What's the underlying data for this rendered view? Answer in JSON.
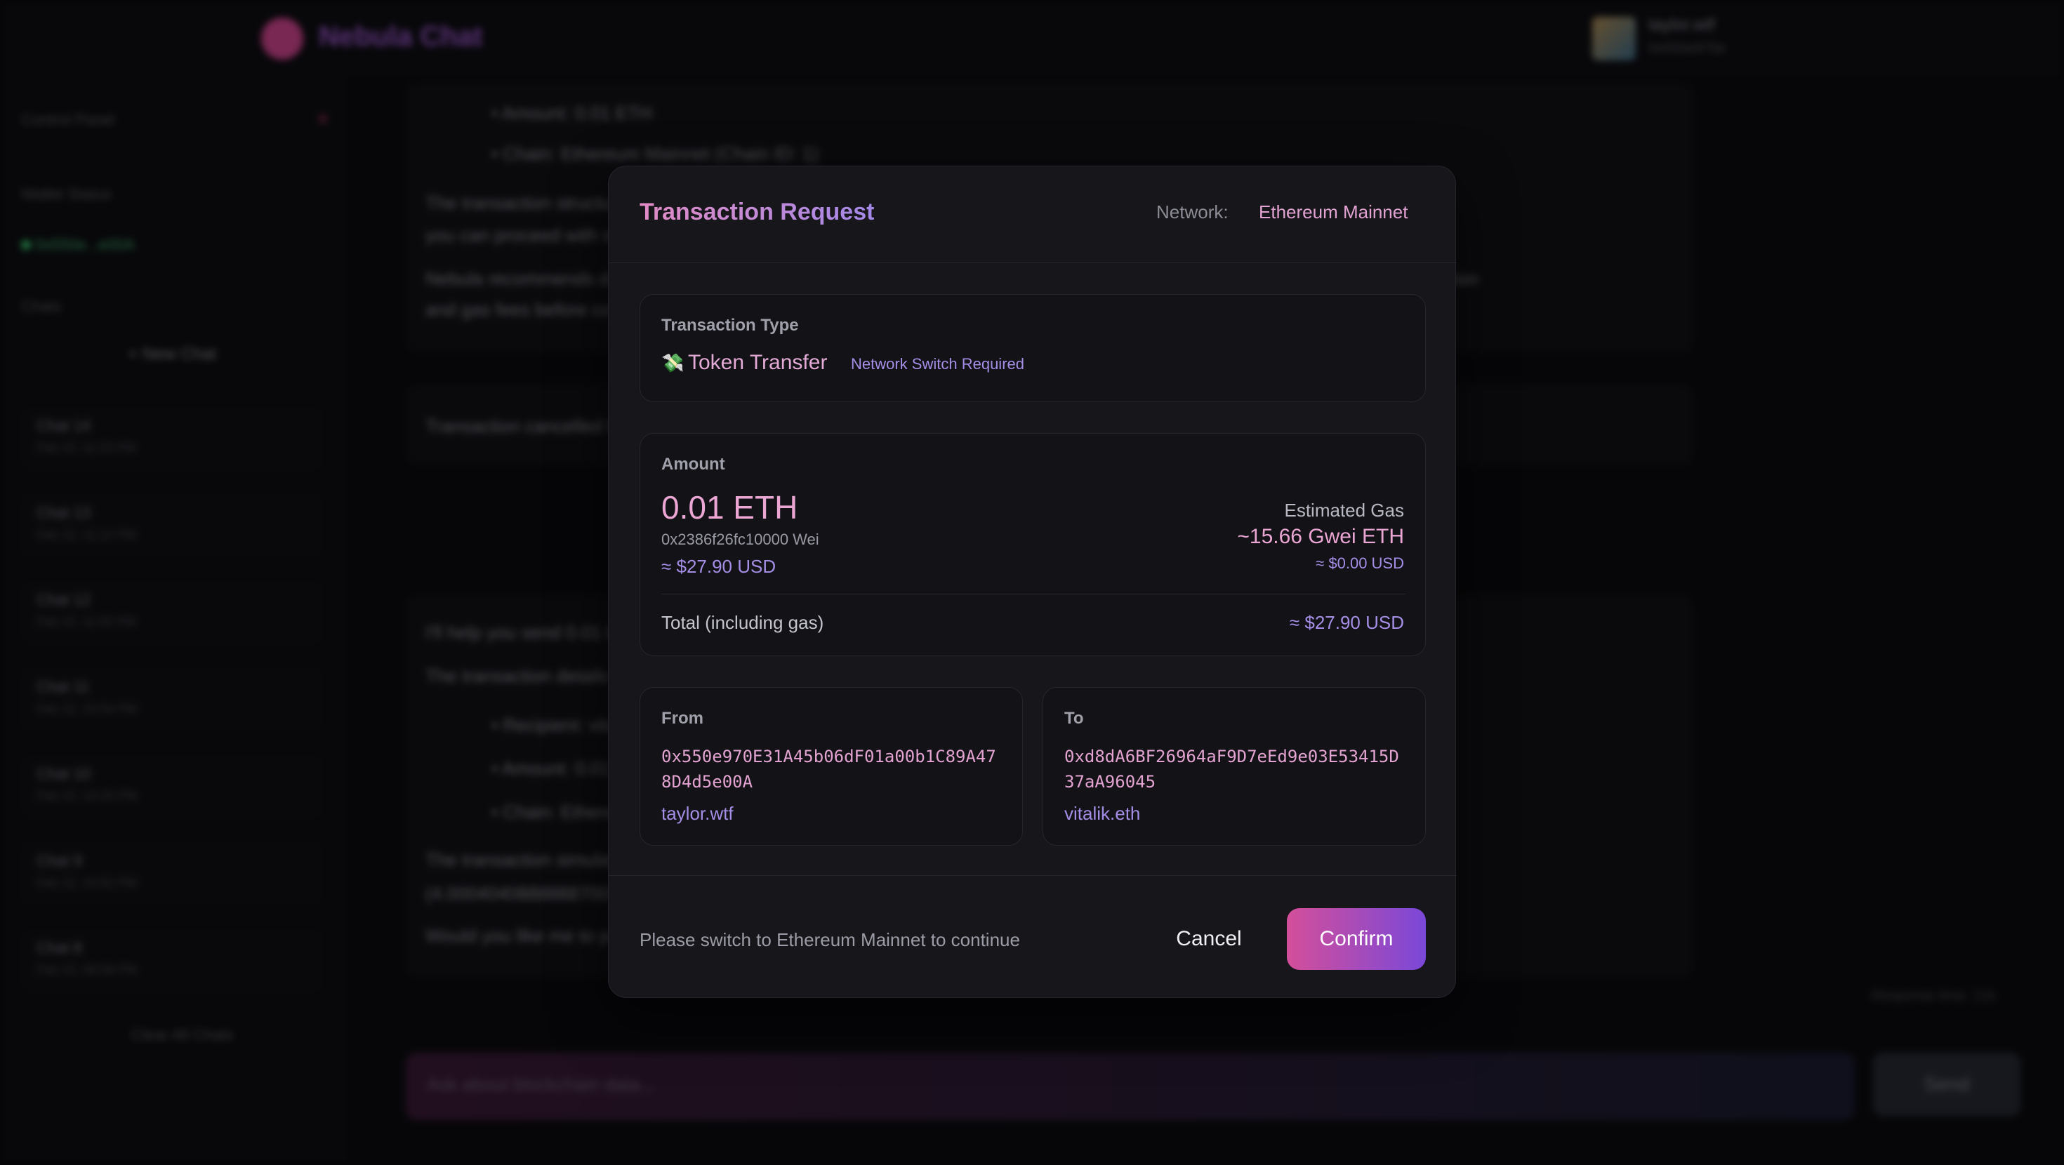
{
  "app": {
    "brand_name": "Nebula Chat",
    "user_name": "taylor.wtf",
    "user_sub": "0x550e970e"
  },
  "sidebar": {
    "control_panel_label": "Control Panel",
    "wallet_status_label": "Wallet Status",
    "wallet_address": "0x550e...e00A",
    "chats_label": "Chats",
    "new_chat_label": "+ New Chat",
    "chats": [
      {
        "title": "Chat 14",
        "date": "Feb 22, 11:23 PM"
      },
      {
        "title": "Chat 13",
        "date": "Feb 22, 11:12 PM"
      },
      {
        "title": "Chat 12",
        "date": "Feb 22, 11:02 PM"
      },
      {
        "title": "Chat 11",
        "date": "Feb 22, 10:54 PM"
      },
      {
        "title": "Chat 10",
        "date": "Feb 22, 10:20 PM"
      },
      {
        "title": "Chat 9",
        "date": "Feb 22, 10:02 PM"
      },
      {
        "title": "Chat 8",
        "date": "Feb 22, 09:58 PM"
      }
    ],
    "clear_all_label": "Clear All Chats"
  },
  "conversation": {
    "lines": [
      "• Amount: 0.01 ETH",
      "• Chain: Ethereum Mainnet (Chain ID: 1)",
      "The transaction structure looks correct, and your wallet connection is successfully prepared, and",
      "you can proceed with signing and sending the transaction through your wallet.",
      "Nebula recommends double-checking the recipient address and ensuring you have sufficient ETH balance to cover the transaction",
      "and gas fees before confirming.",
      "Transaction cancelled by user.",
      "I'll help you send 0.01 ETH to vitalik.eth.",
      "The transaction details are:",
      "• Recipient: vitalik.eth",
      "• Amount: 0.01 ETH",
      "• Chain: Ethereum Mainnet",
      "The transaction simulation indicates the transfer can proceed successfully. Your wallet has sufficient ETH balance",
      "(4.000404088888870000 ETH) to complete this transaction.",
      "Would you like me to proceed with this transaction?"
    ],
    "response_time": "Response time: 12s",
    "composer_placeholder": "Ask about blockchain data...",
    "send_label": "Send"
  },
  "modal": {
    "title": "Transaction Request",
    "network_label": "Network:",
    "network_value": "Ethereum Mainnet",
    "type": {
      "label": "Transaction Type",
      "icon": "money-wings-icon",
      "icon_glyph": "💸",
      "value": "Token Transfer",
      "badge": "Network Switch Required"
    },
    "amount": {
      "label": "Amount",
      "value": "0.01 ETH",
      "wei": "0x2386f26fc10000 Wei",
      "usd": "≈ $27.90 USD",
      "gas_label": "Estimated Gas",
      "gas_value": "~15.66 Gwei ETH",
      "gas_usd": "≈ $0.00 USD",
      "total_label": "Total (including gas)",
      "total_value": "≈ $27.90 USD"
    },
    "from": {
      "label": "From",
      "address": "0x550e970E31A45b06dF01a00b1C89A478D4d5e00A",
      "ens": "taylor.wtf"
    },
    "to": {
      "label": "To",
      "address": "0xd8dA6BF26964aF9D7eEd9e03E53415D37aA96045",
      "ens": "vitalik.eth"
    },
    "footer_message": "Please switch to Ethereum Mainnet to continue",
    "cancel_label": "Cancel",
    "confirm_label": "Confirm"
  },
  "colors": {
    "accent_pink": "#e3a3d0",
    "accent_purple": "#a58ee6",
    "confirm_gradient_start": "#d44f9a",
    "confirm_gradient_end": "#7a48d8",
    "modal_bg": "#16161b"
  }
}
